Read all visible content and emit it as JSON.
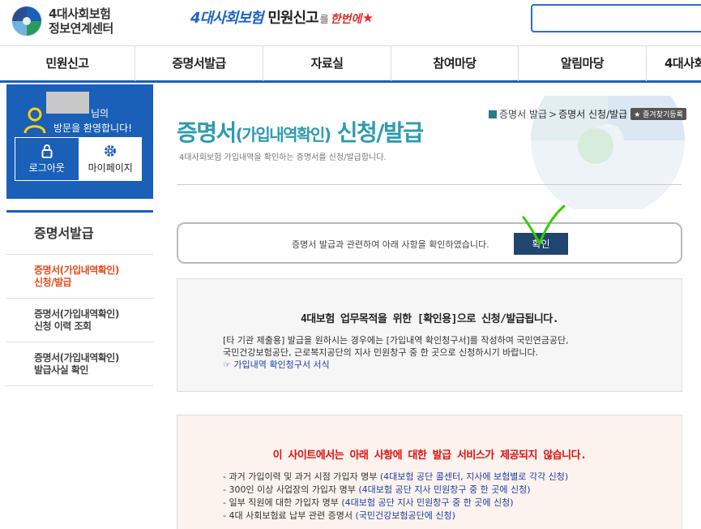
{
  "header": {
    "logo_line1": "4대사회보험",
    "logo_line2": "정보연계센터",
    "slogan_blue": "4대사회보험",
    "slogan_dark": "민원신고",
    "slogan_small": "를",
    "slogan_red": "한번에"
  },
  "nav": [
    "민원신고",
    "증명서발급",
    "자료실",
    "참여마당",
    "알림마당",
    "4대사회"
  ],
  "user": {
    "suffix": "님의",
    "welcome": "방문을 환영합니다!",
    "logout_label": "로그아웃",
    "mypage_label": "마이페이지"
  },
  "sidebar": {
    "title": "증명서발급",
    "items": [
      {
        "line1": "증명서(가입내역확인)",
        "line2": "신청/발급"
      },
      {
        "line1": "증명서(가입내역확인)",
        "line2": "신청 이력 조회"
      },
      {
        "line1": "증명서(가입내역확인)",
        "line2": "발급사실 확인"
      }
    ]
  },
  "breadcrumb": {
    "parent": "증명서 발급",
    "sep": ">",
    "current": "증명서 신청/발급",
    "favorite_label": "즐겨찾기등록"
  },
  "page": {
    "title_main": "증명서",
    "title_paren": "(가입내역확인)",
    "title_tail": " 신청/발급",
    "description": "4대사회보험 가입내역을 확인하는 증명서를 신청/발급합니다."
  },
  "confirm": {
    "text": "증명서 발급과 관련하여 아래 사항을 확인하였습니다.",
    "button_label": "확인"
  },
  "info": {
    "title": "4대보험 업무목적을 위한 [확인용]으로 신청/발급됩니다.",
    "body_line1": "[타 기관 제출용] 발급을 원하시는 경우에는 [가입내역 확인청구서]를 작성하여 국민연금공단,",
    "body_line2": "국민건강보험공단, 근로복지공단의 지사 민원창구 중 한 곳으로 신청하시기 바랍니다.",
    "link": "☞ 가입내역 확인청구서 서식"
  },
  "warning": {
    "title": "이 사이트에서는 아래 사항에 대한 발급 서비스가 제공되지 않습니다.",
    "items": [
      {
        "text": "- 과거 가입이력 및 과거 시점 가입자 명부 ",
        "hl": "(4대보험 공단 콜센터, 지사에 보험별로 각각 신청)"
      },
      {
        "text": "- 300인 이상 사업장의 가입자 명부 ",
        "hl": "(4대보험 공단 지사 민원창구 중 한 곳에 신청)"
      },
      {
        "text": "- 일부 직원에 대한 가입자 명부 ",
        "hl": "(4대보험 공단 지사 민원창구 중 한 곳에 신청)"
      },
      {
        "text": "- 4대 사회보험료 납부 관련 증명서 ",
        "hl": "(국민건강보험공단에 신청)"
      }
    ]
  },
  "colors": {
    "brand_blue": "#1a5fb8",
    "title_teal": "#2d9bb0",
    "active_orange": "#e64a19",
    "warn_red": "#e01010",
    "button_navy": "#20456e",
    "check_green": "#33cc00"
  },
  "icons": [
    "logo-icon",
    "search-field",
    "user-icon",
    "lock-icon",
    "gear-icon",
    "home-icon",
    "star-icon",
    "checkmark-icon"
  ]
}
